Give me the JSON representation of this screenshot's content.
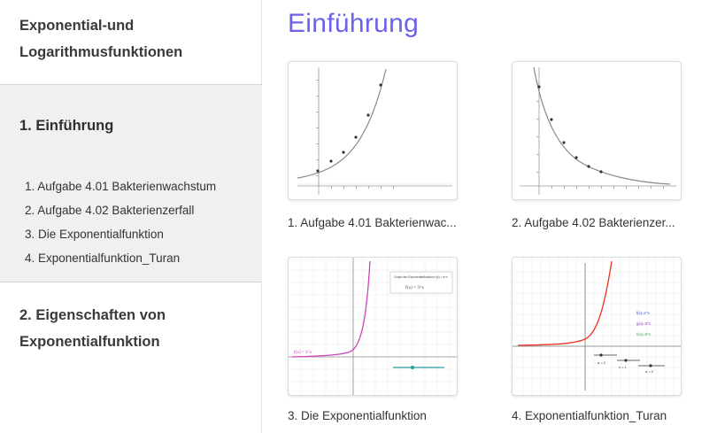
{
  "sidebar": {
    "book_title": "Exponential-und Logarithmusfunktionen",
    "active_chapter": {
      "title": "1. Einführung",
      "items": [
        {
          "label": "1. Aufgabe 4.01 Bakterienwachstum"
        },
        {
          "label": "2. Aufgabe 4.02 Bakterienzerfall"
        },
        {
          "label": "3. Die Exponentialfunktion"
        },
        {
          "label": "4. Exponentialfunktion_Turan"
        }
      ]
    },
    "chapter_2": {
      "title": "2. Eigenschaften von Exponentialfunktion"
    }
  },
  "main": {
    "title": "Einführung",
    "cards": [
      {
        "caption": "1. Aufgabe 4.01 Bakterienwac..."
      },
      {
        "caption": "2. Aufgabe 4.02 Bakterienzer..."
      },
      {
        "caption": "3. Die Exponentialfunktion",
        "graph_label": "f(x) = 3^x",
        "panel_text": "Graph der Exponentialfunktion f(x) = a^x"
      },
      {
        "caption": "4. Exponentialfunktion_Turan",
        "legend": [
          "f(x)=2^x",
          "g(x)=3^x",
          "h(x)=5^x"
        ],
        "slider_labels": [
          "a = 2",
          "c = 1",
          "d = 0"
        ]
      }
    ]
  },
  "colors": {
    "accent": "#6c63e6",
    "active_chapter_bg": "#f0f0f0",
    "curve_gray": "#777777",
    "curve_magenta": "#cc44bb",
    "curve_red": "#ee3322"
  }
}
